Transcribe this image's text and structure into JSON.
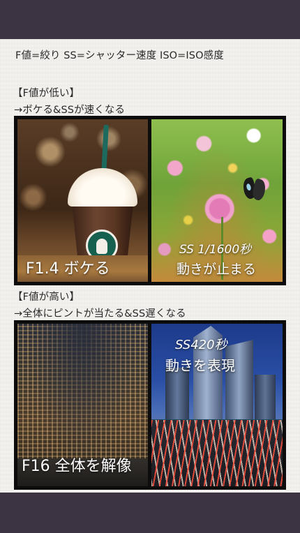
{
  "legend": "F値=絞り SS=シャッター速度 ISO=ISO感度",
  "section_low": {
    "heading": "【F値が低い】",
    "summary": "→ボケる&SSが速くなる",
    "photo_left_caption": "F1.4 ボケる",
    "photo_right_caption_speed": "SS 1/1600秒",
    "photo_right_caption_effect": "動きが止まる"
  },
  "section_high": {
    "heading": "【F値が高い】",
    "summary": "→全体にピントが当たる&SS遅くなる",
    "photo_left_caption": "F16 全体を解像",
    "photo_right_caption_speed": "SS420秒",
    "photo_right_caption_effect": "動きを表現"
  }
}
